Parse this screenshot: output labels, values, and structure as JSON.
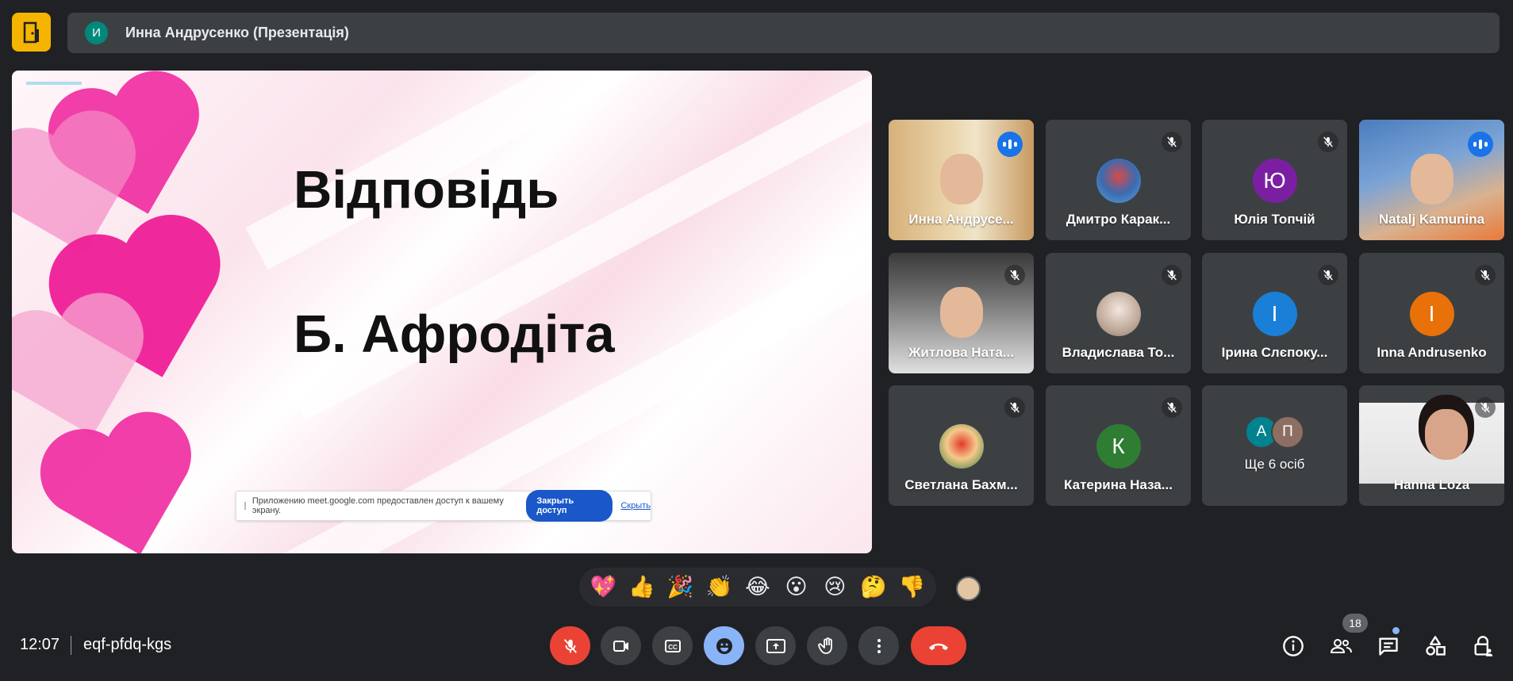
{
  "header": {
    "presenter_initial": "И",
    "presenter_label": "Инна Андрусенко (Презентація)"
  },
  "slide": {
    "title": "Відповідь",
    "answer": "Б. Афродіта",
    "share_notice_text": "Приложению meet.google.com предоставлен доступ к вашему экрану.",
    "stop_share_label": "Закрыть доступ",
    "hide_label": "Скрыть"
  },
  "participants": [
    {
      "name": "Инна Андрусе...",
      "state": "speaking",
      "kind": "video"
    },
    {
      "name": "Дмитро Карак...",
      "state": "muted",
      "kind": "photo"
    },
    {
      "name": "Юлія Топчій",
      "state": "muted",
      "kind": "initial",
      "initial": "Ю",
      "color": "#7b1fa2"
    },
    {
      "name": "Natalj Kamunina",
      "state": "speaking",
      "kind": "video",
      "active": true
    },
    {
      "name": "Житлова Ната...",
      "state": "muted",
      "kind": "video"
    },
    {
      "name": "Владислава То...",
      "state": "muted",
      "kind": "photo"
    },
    {
      "name": "Ірина Слєпоку...",
      "state": "muted",
      "kind": "initial",
      "initial": "І",
      "color": "#1a7fd6"
    },
    {
      "name": "Inna Andrusenko",
      "state": "muted",
      "kind": "initial",
      "initial": "I",
      "color": "#e8710a"
    },
    {
      "name": "Светлана Бахм...",
      "state": "muted",
      "kind": "photo"
    },
    {
      "name": "Катерина Наза...",
      "state": "muted",
      "kind": "initial",
      "initial": "К",
      "color": "#2e7d32"
    },
    {
      "name": "Ще 6 осіб",
      "kind": "more",
      "initials": [
        "А",
        "П"
      ]
    },
    {
      "name": "Hanna Loza",
      "state": "muted",
      "kind": "video"
    }
  ],
  "reactions": [
    "💖",
    "👍",
    "🎉",
    "👏",
    "😂",
    "😮",
    "😢",
    "🤔",
    "👎"
  ],
  "footer": {
    "time": "12:07",
    "meeting_code": "eqf-pfdq-kgs",
    "participant_count": "18"
  },
  "colors": {
    "background": "#202124",
    "tile": "#3c4043",
    "end_call": "#ea4335",
    "accent": "#8ab4f8",
    "speaking": "#1a73e8"
  }
}
